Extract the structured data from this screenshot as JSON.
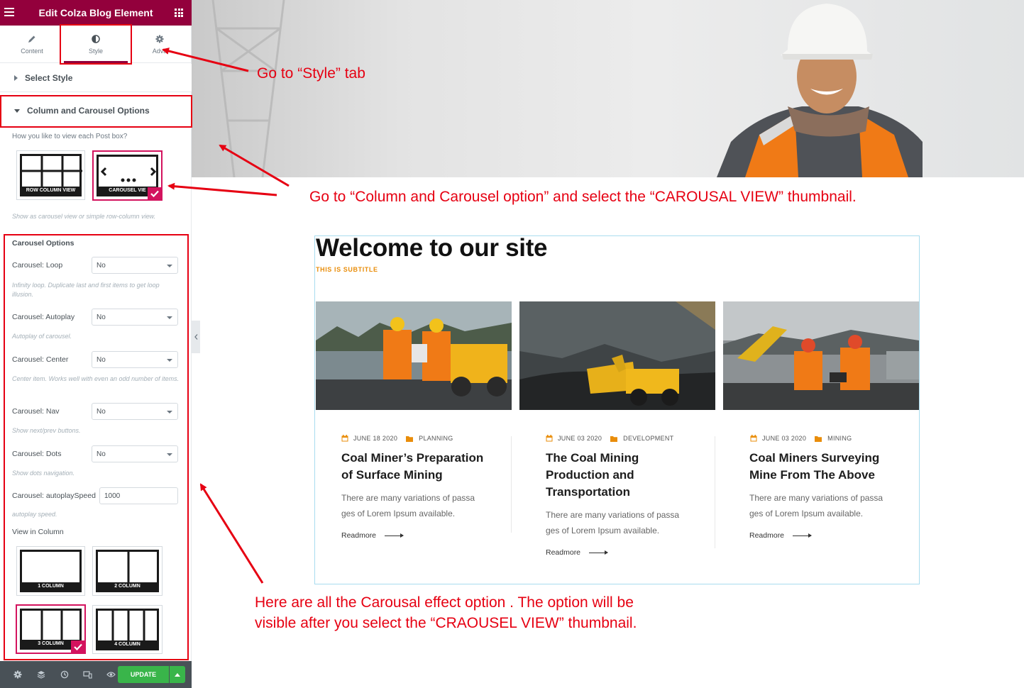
{
  "panel": {
    "title": "Edit Colza Blog Element",
    "tabs": [
      {
        "label": "Content",
        "icon": "pencil-icon"
      },
      {
        "label": "Style",
        "icon": "contrast-icon"
      },
      {
        "label": "Advanced",
        "label_visible": "Adva",
        "icon": "gear-icon"
      }
    ],
    "sections": {
      "select_style": "Select Style",
      "column_carousel": "Column and Carousel Options"
    },
    "view_question": "How you like to view each Post box?",
    "view_options": [
      {
        "label": "ROW COLUMN VIEW",
        "selected": false
      },
      {
        "label": "CAROUSEL VIEW",
        "label_visible": "CAROUSEL VIE",
        "selected": true
      }
    ],
    "view_hint": "Show as carousel view or simple row-column view.",
    "carousel_heading": "Carousel Options",
    "fields": [
      {
        "label": "Carousel: Loop",
        "value": "No",
        "hint": "Infinity loop. Duplicate last and first items to get loop illusion."
      },
      {
        "label": "Carousel: Autoplay",
        "value": "No",
        "hint": "Autoplay of carousel."
      },
      {
        "label": "Carousel: Center",
        "value": "No",
        "hint": "Center item. Works well with even an odd number of items."
      },
      {
        "label": "Carousel: Nav",
        "value": "No",
        "hint": "Show next/prev buttons."
      },
      {
        "label": "Carousel: Dots",
        "value": "No",
        "hint": "Show dots navigation."
      }
    ],
    "speed": {
      "label": "Carousel: autoplaySpeed",
      "value": "1000",
      "hint": "autoplay speed."
    },
    "view_column_label": "View in Column",
    "columns": [
      {
        "label": "1 COLUMN",
        "selected": false
      },
      {
        "label": "2 COLUMN",
        "selected": false
      },
      {
        "label": "3 COLUMN",
        "selected": true
      },
      {
        "label": "4 COLUMN",
        "selected": false
      }
    ],
    "update_label": "UPDATE"
  },
  "annotations": {
    "style_tab": "Go  to “Style” tab",
    "carousel_option": "Go to “Column and Carousel option” and select the “CAROUSAL VIEW” thumbnail.",
    "effects_line1": "Here are all the Carousal effect option . The option will be",
    "effects_line2": "visible after you select the “CRAOUSEL VIEW” thumbnail.",
    "color": "#e60012"
  },
  "preview": {
    "heading": "Welcome to our site",
    "subtitle": "THIS IS SUBTITLE",
    "posts": [
      {
        "date": "JUNE 18 2020",
        "category": "PLANNING",
        "title_lines": [
          "Coal Miner’s Preparation",
          "of Surface Mining"
        ],
        "text_lines": [
          "There are many variations of passa",
          "ges of Lorem Ipsum available."
        ],
        "readmore": "Readmore"
      },
      {
        "date": "JUNE 03 2020",
        "category": "DEVELOPMENT",
        "title_lines": [
          "The Coal Mining",
          "Production and",
          "Transportation"
        ],
        "text_lines": [
          "There are many variations of passa",
          "ges of Lorem Ipsum available."
        ],
        "readmore": "Readmore"
      },
      {
        "date": "JUNE 03 2020",
        "category": "MINING",
        "title_lines": [
          "Coal Miners Surveying",
          "Mine From The Above"
        ],
        "text_lines": [
          "There are many variations of passa",
          "ges of Lorem Ipsum available."
        ],
        "readmore": "Readmore"
      }
    ],
    "accent": "#e98d0a"
  },
  "colors": {
    "brand": "#93003c",
    "selected": "#d3135e",
    "update": "#39b54a",
    "footer": "#495157"
  }
}
